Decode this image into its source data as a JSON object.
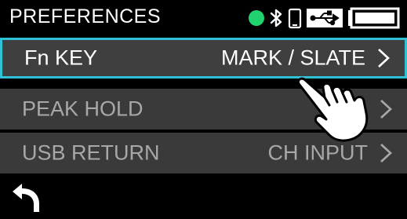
{
  "header": {
    "title": "PREFERENCES",
    "status_icons": [
      "status-led-icon",
      "bluetooth-icon",
      "phone-icon",
      "usb-icon",
      "battery-icon"
    ],
    "status_led_color": "#21d36f"
  },
  "menu": {
    "items": [
      {
        "label": "Fn KEY",
        "value": "MARK / SLATE",
        "chevron": ">",
        "selected": true
      },
      {
        "label": "PEAK HOLD",
        "value": "",
        "chevron": ">",
        "selected": false
      },
      {
        "label": "USB RETURN",
        "value": "CH INPUT",
        "chevron": ">",
        "selected": false
      }
    ]
  },
  "footer": {
    "back_icon": "back-arrow-icon"
  },
  "overlay": {
    "pointer_icon": "hand-pointer-icon"
  },
  "colors": {
    "accent": "#2fc2d6",
    "row_bg": "#3a3a3a",
    "text_selected": "#ffffff",
    "text_dim": "#a8a8a8"
  }
}
